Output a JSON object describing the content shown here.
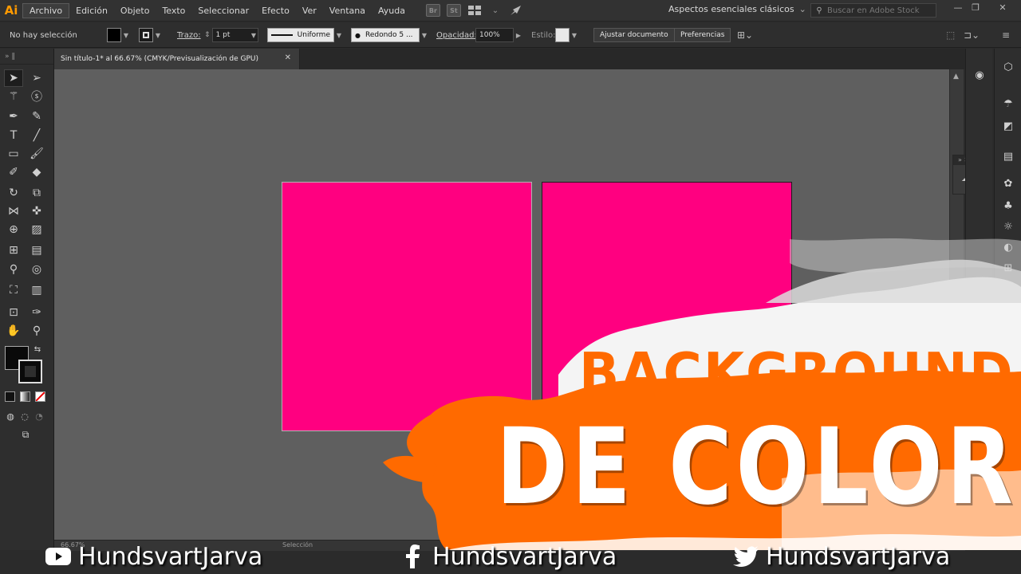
{
  "menubar": {
    "app_logo": "Ai",
    "items": [
      "Archivo",
      "Edición",
      "Objeto",
      "Texto",
      "Seleccionar",
      "Efecto",
      "Ver",
      "Ventana",
      "Ayuda"
    ],
    "bridge_icon": "Br",
    "stock_icon": "St",
    "workspace": "Aspectos esenciales clásicos",
    "search_placeholder": "Buscar en Adobe Stock"
  },
  "controlbar": {
    "selection_status": "No hay selección",
    "stroke_label": "Trazo:",
    "stroke_weight": "1 pt",
    "stroke_style": "Uniforme",
    "brush": "Redondo 5 ...",
    "opacity_label": "Opacidad:",
    "opacity_value": "100%",
    "style_label": "Estilo:",
    "adjust_button": "Ajustar documento",
    "prefs_button": "Preferencias"
  },
  "document": {
    "tab_title": "Sin título-1* al 66.67% (CMYK/Previsualización de GPU)",
    "artboard_color": "#ff0080",
    "canvas_color": "#5f5f5f"
  },
  "statusbar": {
    "zoom": "66.67%",
    "tool": "Selección"
  },
  "overlay": {
    "line1": "BACKGROUND",
    "line2": "DE COLOR",
    "accent": "#ff6a00"
  },
  "social": {
    "youtube": "HundsvartJarva",
    "facebook": "HundsvartJarva",
    "twitter": "HundsvartJarva"
  },
  "icons": [
    "select-arrow-icon",
    "direct-select-icon",
    "magic-wand-icon",
    "lasso-icon",
    "pen-icon",
    "curvature-icon",
    "type-icon",
    "line-icon",
    "rectangle-icon",
    "brush-icon",
    "shaper-icon",
    "eraser-icon",
    "rotate-icon",
    "scale-icon",
    "width-icon",
    "puppet-icon",
    "shape-builder-icon",
    "perspective-icon",
    "mesh-icon",
    "gradient-icon",
    "eyedropper-icon",
    "blend-icon",
    "symbol-sprayer-icon",
    "column-graph-icon",
    "artboard-icon",
    "slice-icon",
    "hand-icon",
    "zoom-icon"
  ]
}
